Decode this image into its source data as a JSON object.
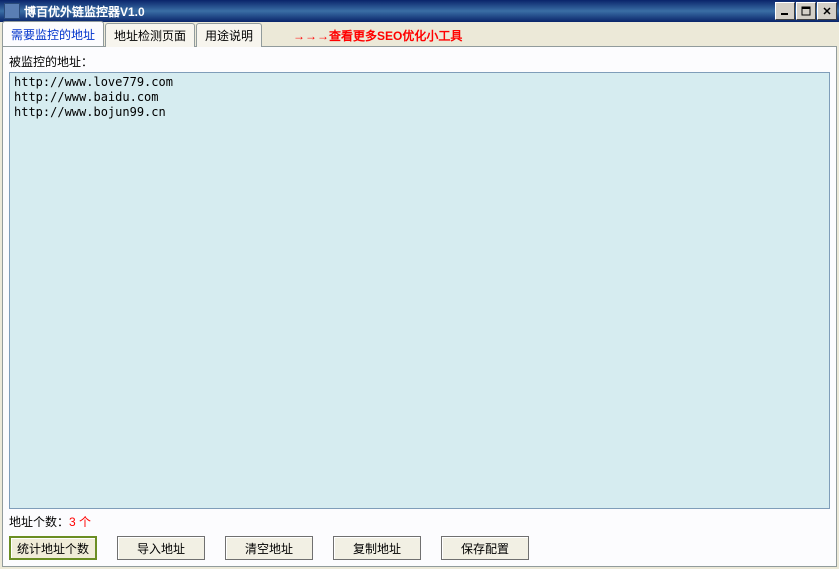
{
  "window": {
    "title": "博百优外链监控器V1.0"
  },
  "tabs": [
    {
      "label": "需要监控的地址",
      "active": true
    },
    {
      "label": "地址检测页面",
      "active": false
    },
    {
      "label": "用途说明",
      "active": false
    }
  ],
  "promo_text": "→→→查看更多SEO优化小工具",
  "panel": {
    "list_label": "被监控的地址：",
    "addresses": "http://www.love779.com\nhttp://www.baidu.com\nhttp://www.bojun99.cn",
    "count_label": "地址个数：",
    "count_value": "3 个"
  },
  "buttons": {
    "stat": "统计地址个数",
    "import": "导入地址",
    "clear": "清空地址",
    "copy": "复制地址",
    "save": "保存配置"
  }
}
